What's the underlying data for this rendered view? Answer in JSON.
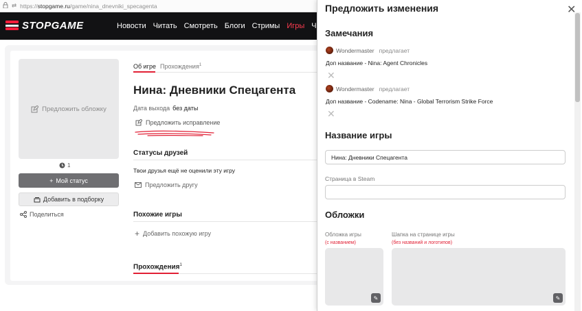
{
  "browser": {
    "url_prefix": "https://",
    "url_domain": "stopgame.ru",
    "url_path": "/game/nina_dnevniki_specagenta"
  },
  "header": {
    "logo": "STOPGAME",
    "nav": [
      {
        "label": "Новости",
        "active": false
      },
      {
        "label": "Читать",
        "active": false
      },
      {
        "label": "Смотреть",
        "active": false
      },
      {
        "label": "Блоги",
        "active": false
      },
      {
        "label": "Стримы",
        "active": false
      },
      {
        "label": "Игры",
        "active": true
      },
      {
        "label": "Читы",
        "active": false
      }
    ]
  },
  "sidebar": {
    "cover_label": "Предложить обложку",
    "cover_count": "1",
    "status_button": "Мой статус",
    "collection_button": "Добавить в подборку",
    "share": "Поделиться"
  },
  "game": {
    "tabs": [
      {
        "label": "Об игре",
        "badge": ""
      },
      {
        "label": "Прохождения",
        "badge": "1"
      }
    ],
    "title": "Нина: Дневники Спецагента",
    "release_label": "Дата выхода",
    "release_value": "без даты",
    "suggest_fix": "Предложить исправление",
    "friends_heading": "Статусы друзей",
    "friends_text": "Твои друзья ещё не оценили эту игру",
    "suggest_friend": "Предложить другу",
    "similar_heading": "Похожие игры",
    "add_similar": "Добавить похожую игру",
    "walkthroughs_heading": "Прохождения",
    "walkthroughs_badge": "1"
  },
  "modal": {
    "title": "Предложить изменения",
    "notes_heading": "Замечания",
    "notes": [
      {
        "user": "Wondermaster",
        "verb": "предлагает",
        "text": "Доп название - Nina: Agent Chronicles"
      },
      {
        "user": "Wondermaster",
        "verb": "предлагает",
        "text": "Доп название - Codename: Nina - Global Terrorism Strike Force"
      }
    ],
    "name_heading": "Название игры",
    "name_value": "Нина: Дневники Спецагента",
    "steam_label": "Страница в Steam",
    "steam_value": "",
    "covers_heading": "Обложки",
    "cover_label": "Обложка игры",
    "cover_note": "(с названием)",
    "banner_label": "Шапка на странице игры",
    "banner_note": "(без названий и логотипов)"
  },
  "colors": {
    "accent": "#e11f34",
    "header_bg": "#121214",
    "nav_active": "#ff3d50"
  }
}
